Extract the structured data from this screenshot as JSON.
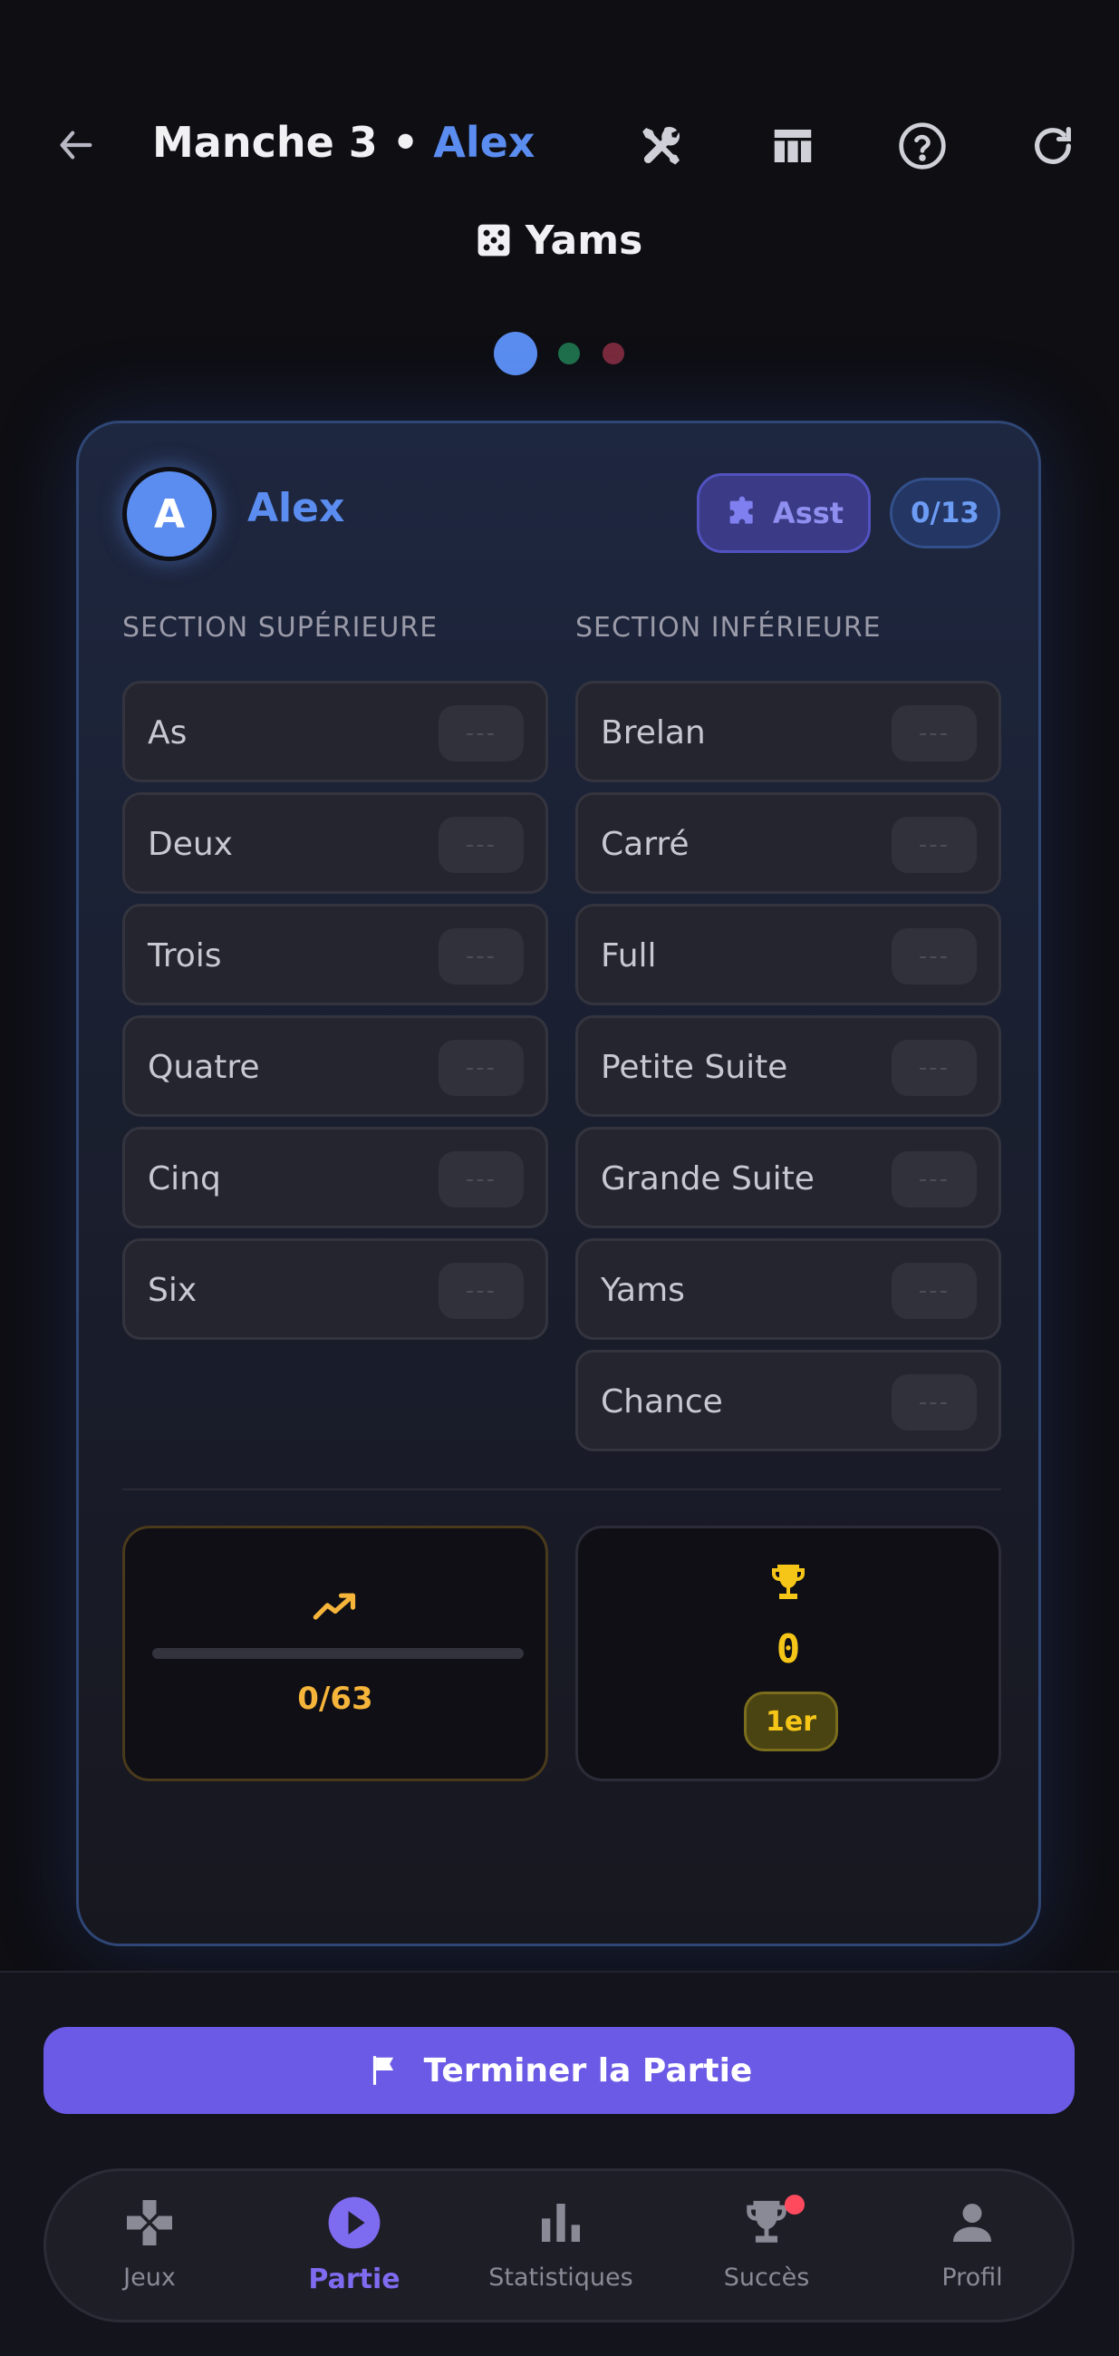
{
  "header": {
    "title_prefix": "Manche 3 • ",
    "title_player": "Alex"
  },
  "game": {
    "name": "Yams"
  },
  "pager": {
    "active_index": 0,
    "colors": [
      "#5b8df0",
      "#1f6e4a",
      "#7a2a3c"
    ]
  },
  "player": {
    "initial": "A",
    "name": "Alex",
    "assist_label": "Asst",
    "progress_badge": "0/13",
    "accent_color": "#5b8df0"
  },
  "sections": {
    "upper": {
      "label": "SECTION SUPÉRIEURE",
      "rows": [
        {
          "label": "As",
          "value": "---"
        },
        {
          "label": "Deux",
          "value": "---"
        },
        {
          "label": "Trois",
          "value": "---"
        },
        {
          "label": "Quatre",
          "value": "---"
        },
        {
          "label": "Cinq",
          "value": "---"
        },
        {
          "label": "Six",
          "value": "---"
        }
      ]
    },
    "lower": {
      "label": "SECTION INFÉRIEURE",
      "rows": [
        {
          "label": "Brelan",
          "value": "---"
        },
        {
          "label": "Carré",
          "value": "---"
        },
        {
          "label": "Full",
          "value": "---"
        },
        {
          "label": "Petite Suite",
          "value": "---"
        },
        {
          "label": "Grande Suite",
          "value": "---"
        },
        {
          "label": "Yams",
          "value": "---"
        },
        {
          "label": "Chance",
          "value": "---"
        }
      ]
    }
  },
  "bonus": {
    "text": "0/63",
    "progress": 0
  },
  "score": {
    "total": "0",
    "rank": "1er"
  },
  "actions": {
    "finish_label": "Terminer la Partie"
  },
  "nav": {
    "items": [
      {
        "label": "Jeux",
        "icon": "gamepad-icon"
      },
      {
        "label": "Partie",
        "icon": "play-icon"
      },
      {
        "label": "Statistiques",
        "icon": "bar-chart-icon"
      },
      {
        "label": "Succès",
        "icon": "trophy-icon"
      },
      {
        "label": "Profil",
        "icon": "person-icon"
      }
    ],
    "active": "Partie"
  }
}
